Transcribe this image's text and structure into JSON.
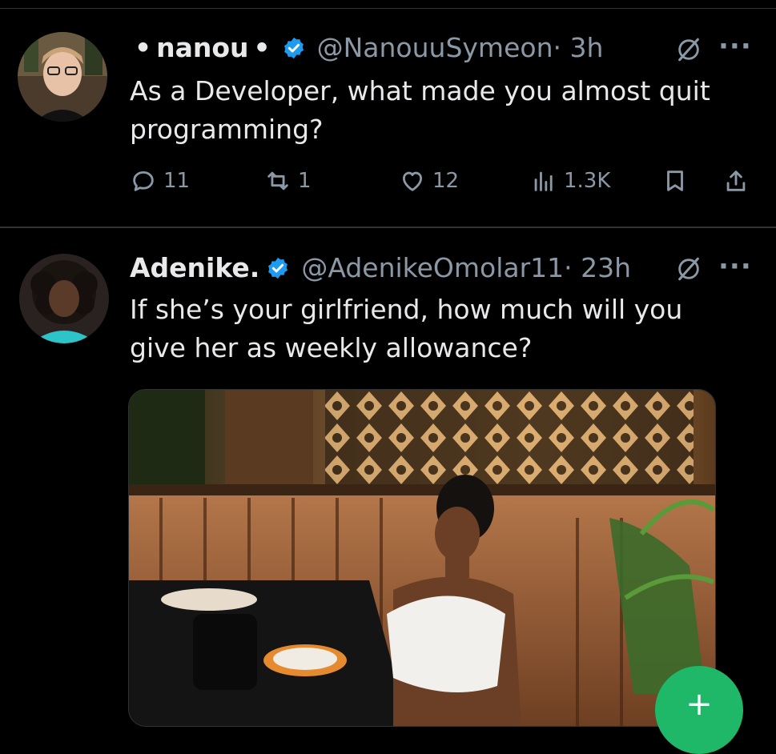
{
  "tweets": [
    {
      "prefix": "•",
      "name": "nanou",
      "suffix": "•",
      "handle": "@NanouuSymeon",
      "time": "· 3h",
      "more": "···",
      "text_lines": [
        "As a Developer, what made you almost quit",
        "programming?"
      ],
      "actions": {
        "replies": "11",
        "reposts": "1",
        "likes": "12",
        "views": "1.3K"
      }
    },
    {
      "name": "Adenike.",
      "handle": "@AdenikeOmolar11",
      "time": "· 23h",
      "more": "···",
      "text_lines": [
        "If she’s your girlfriend, how much will you",
        "give her as weekly allowance?"
      ]
    }
  ],
  "fab": {
    "label": "+"
  },
  "colors": {
    "background": "#000000",
    "text": "#e7e9ea",
    "muted": "#8b98a5",
    "verified": "#1d9bf0",
    "fab": "#1fb868"
  },
  "icons": [
    "verified-badge-icon",
    "grok-icon",
    "more-icon",
    "reply-icon",
    "repost-icon",
    "like-icon",
    "views-icon",
    "bookmark-icon",
    "share-icon"
  ]
}
